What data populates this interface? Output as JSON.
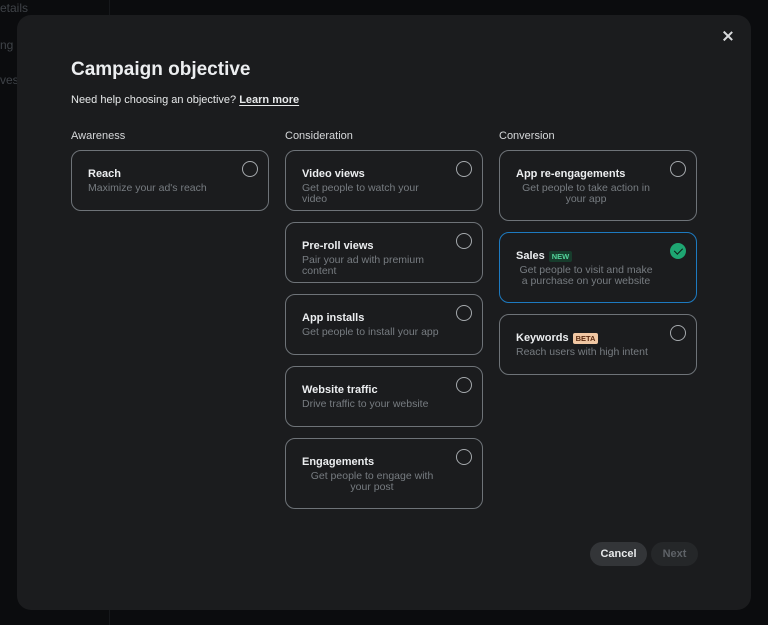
{
  "background": {
    "sidebar_fragments": [
      "etails",
      "ng",
      "ves"
    ]
  },
  "modal": {
    "title": "Campaign objective",
    "help_text": "Need help choosing an objective?",
    "help_link": "Learn more",
    "close_icon": "close-icon",
    "columns": [
      {
        "label": "Awareness",
        "options": [
          {
            "title": "Reach",
            "description": "Maximize your ad's reach",
            "selected": false
          }
        ]
      },
      {
        "label": "Consideration",
        "options": [
          {
            "title": "Video views",
            "description": "Get people to watch your video",
            "selected": false
          },
          {
            "title": "Pre-roll views",
            "description": "Pair your ad with premium content",
            "selected": false
          },
          {
            "title": "App installs",
            "description": "Get people to install your app",
            "selected": false
          },
          {
            "title": "Website traffic",
            "description": "Drive traffic to your website",
            "selected": false
          },
          {
            "title": "Engagements",
            "description": "Get people to engage with your post",
            "selected": false
          }
        ]
      },
      {
        "label": "Conversion",
        "options": [
          {
            "title": "App re-engagements",
            "description": "Get people to take action in your app",
            "selected": false
          },
          {
            "title": "Sales",
            "badge": "NEW",
            "description": "Get people to visit and make a purchase on your website",
            "selected": true
          },
          {
            "title": "Keywords",
            "badge": "BETA",
            "description": "Reach users with high intent",
            "selected": false
          }
        ]
      }
    ],
    "buttons": {
      "cancel": "Cancel",
      "next": "Next"
    },
    "colors": {
      "selected_border": "#1d7ac0",
      "check": "#1ea672",
      "new_badge": "#52d39a",
      "beta_badge": "#f1c7a3"
    }
  }
}
